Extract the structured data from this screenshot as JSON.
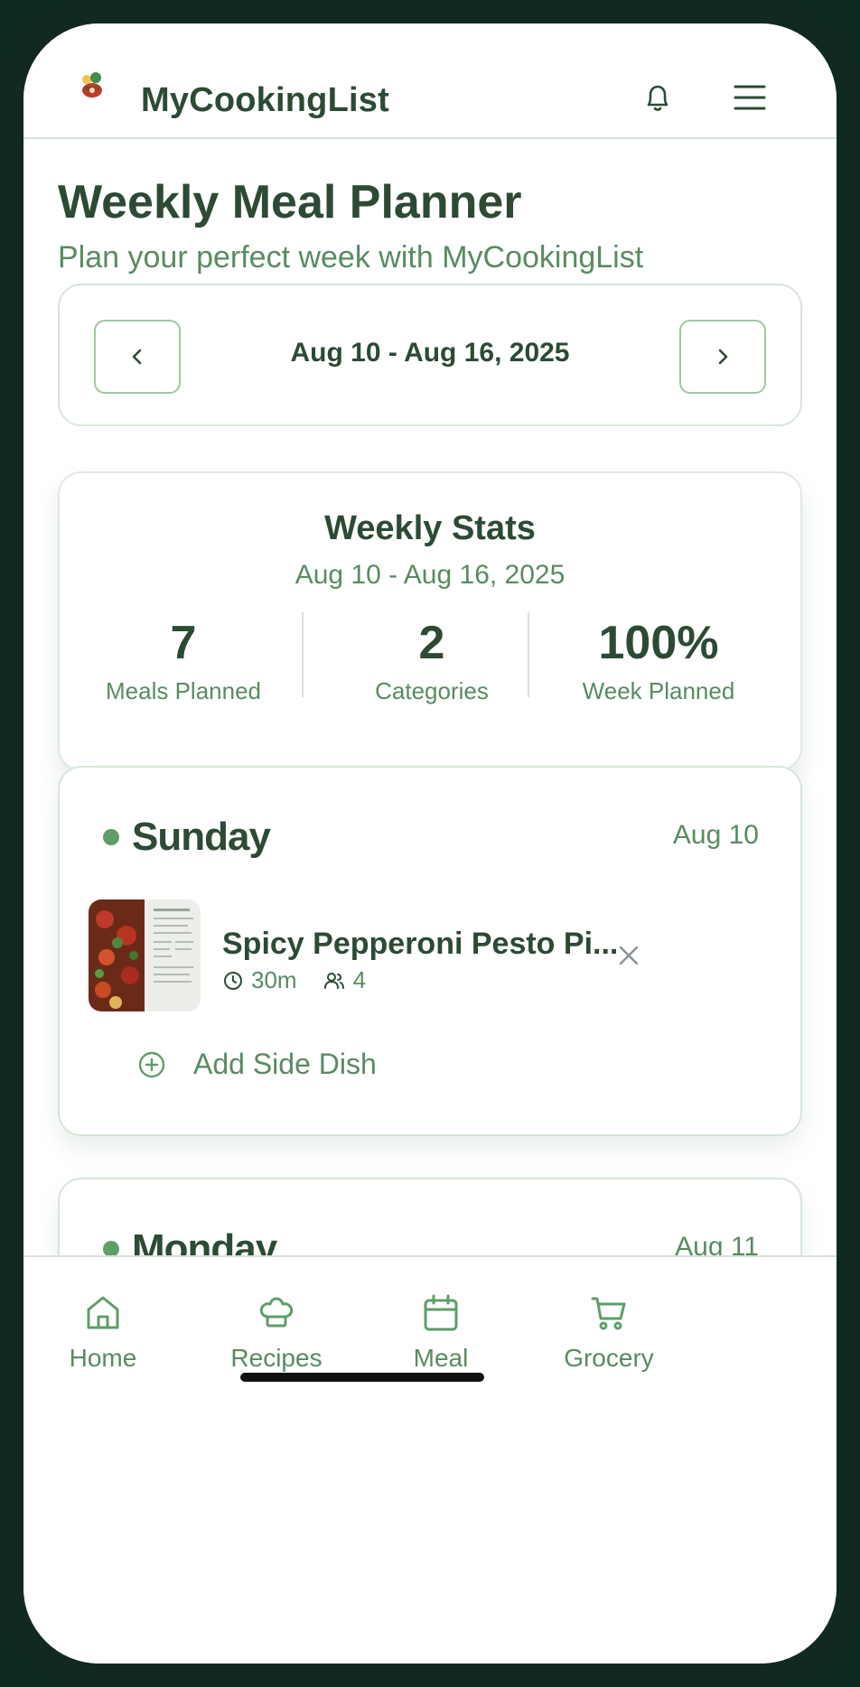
{
  "header": {
    "app_title": "MyCookingList",
    "logo_icon": "chef-logo-icon",
    "bell_icon": "bell-icon",
    "menu_icon": "hamburger-menu-icon"
  },
  "page": {
    "title": "Weekly Meal Planner",
    "subtitle": "Plan your perfect week with MyCookingList"
  },
  "week_nav": {
    "range": "Aug 10 - Aug 16, 2025",
    "prev_icon": "chevron-left-icon",
    "next_icon": "chevron-right-icon"
  },
  "stats": {
    "title": "Weekly Stats",
    "range": "Aug 10 - Aug 16, 2025",
    "items": [
      {
        "value": "7",
        "label": "Meals Planned"
      },
      {
        "value": "2",
        "label": "Categories"
      },
      {
        "value": "100%",
        "label": "Week Planned"
      }
    ]
  },
  "days": [
    {
      "name": "Sunday",
      "date": "Aug 10",
      "meal": {
        "name": "Spicy Pepperoni Pesto Pi...",
        "time": "30m",
        "servings": "4"
      },
      "add_side_label": "Add Side Dish"
    },
    {
      "name": "Monday",
      "date": "Aug 11"
    }
  ],
  "bottom_nav": [
    {
      "label": "Home",
      "icon": "home-icon"
    },
    {
      "label": "Recipes",
      "icon": "chef-hat-icon"
    },
    {
      "label": "Meal",
      "icon": "calendar-icon"
    },
    {
      "label": "Grocery",
      "icon": "cart-icon"
    }
  ],
  "colors": {
    "accent": "#5f9e68",
    "text_dark": "#2d4a34",
    "text_muted": "#5a8a62",
    "frame": "#12291f"
  }
}
